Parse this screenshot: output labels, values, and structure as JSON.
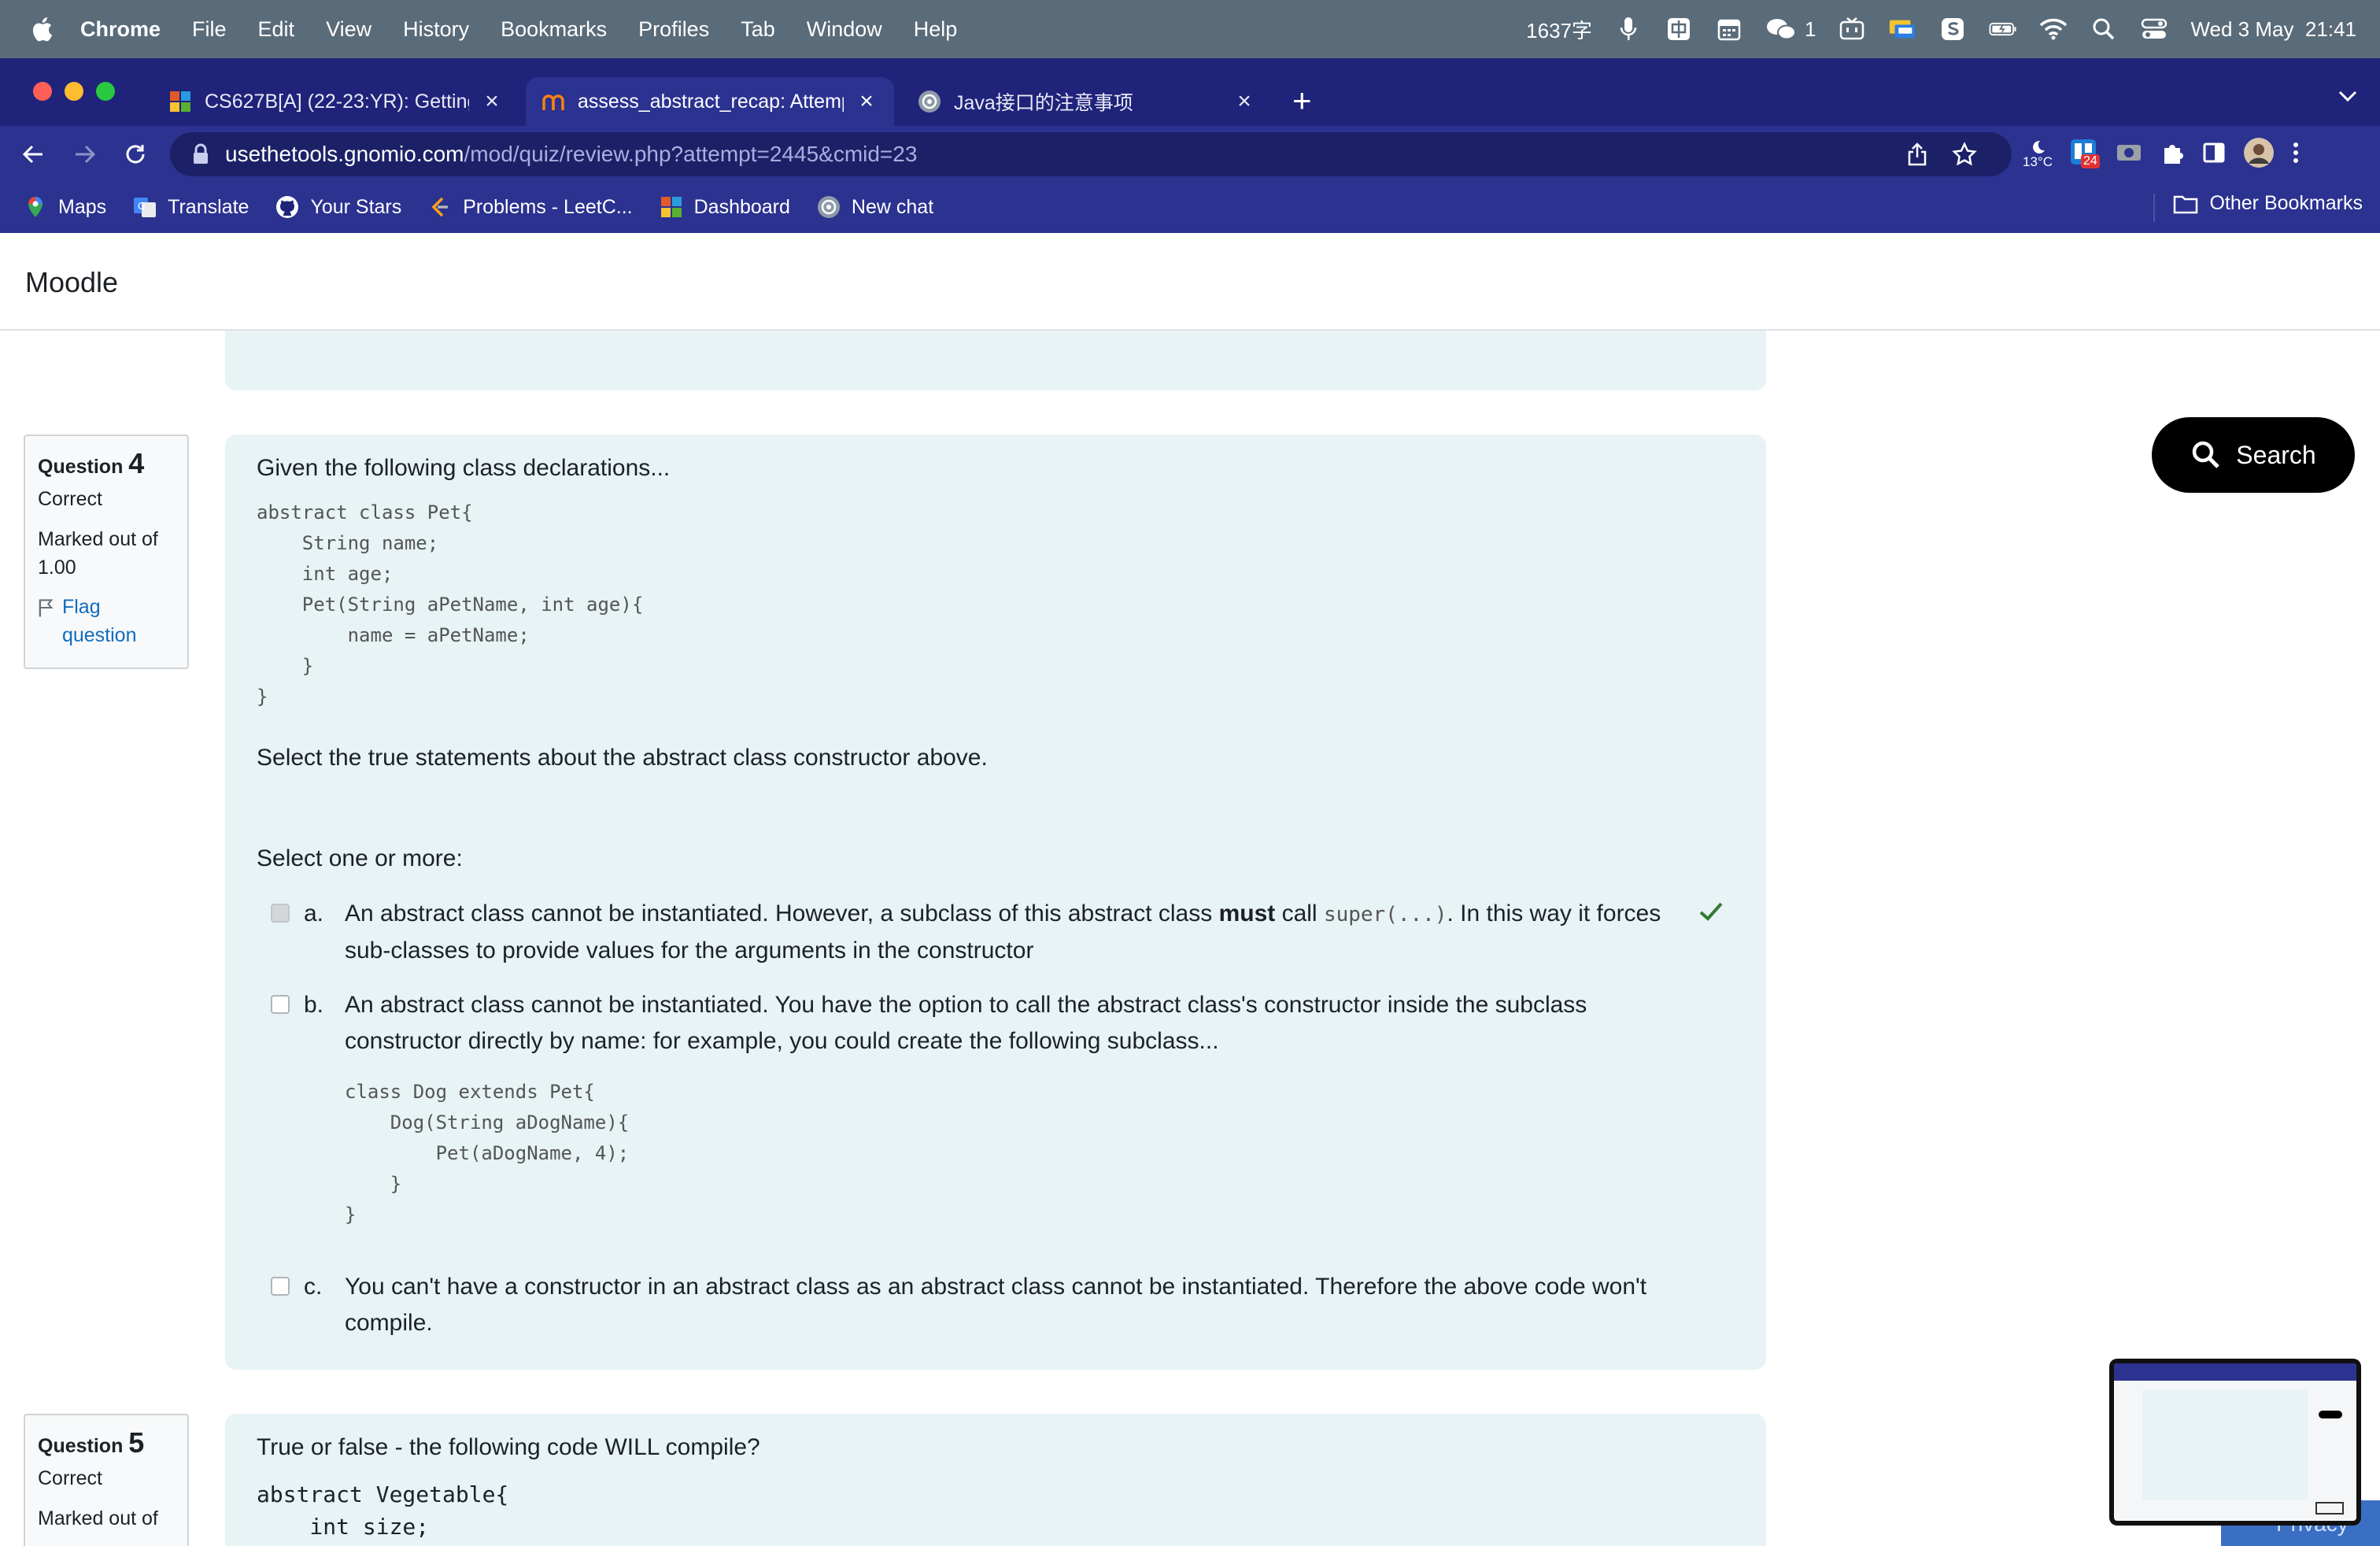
{
  "menubar": {
    "app": "Chrome",
    "items": [
      "File",
      "Edit",
      "View",
      "History",
      "Bookmarks",
      "Profiles",
      "Tab",
      "Window",
      "Help"
    ],
    "input_count": "1637字",
    "wechat_badge": "1",
    "datetime": "Wed 3 May  21:41"
  },
  "tabs": [
    {
      "title": "CS627B[A] (22-23:YR): Getting",
      "active": false
    },
    {
      "title": "assess_abstract_recap: Attemp",
      "active": true
    },
    {
      "title": "Java接口的注意事项",
      "active": false
    }
  ],
  "address": {
    "host": "usethetools.gnomio.com",
    "path": "/mod/quiz/review.php?attempt=2445&cmid=23"
  },
  "extensions": {
    "weather": "13°C",
    "badge": "24"
  },
  "bookmarks": [
    "Maps",
    "Translate",
    "Your Stars",
    "Problems - LeetC...",
    "Dashboard",
    "New chat"
  ],
  "other_bookmarks": "Other Bookmarks",
  "site": {
    "brand": "Moodle"
  },
  "search_button": "Search",
  "q4": {
    "label": "Question",
    "number": "4",
    "state": "Correct",
    "grade": "Marked out of 1.00",
    "flag": "Flag question",
    "intro": "Given the following class declarations...",
    "code": "abstract class Pet{\n    String name;\n    int age;\n    Pet(String aPetName, int age){\n        name = aPetName;\n    }\n}",
    "question": "Select the true statements about the abstract class constructor above.",
    "prompt": "Select one or more:",
    "answers": {
      "a": {
        "letter": "a.",
        "text_before": "An abstract class cannot be instantiated. However, a subclass of this abstract class ",
        "bold": "must",
        "text_mid": " call ",
        "code": "super(...)",
        "text_after": ". In this way it forces sub-classes to provide values for the arguments in the constructor"
      },
      "b": {
        "letter": "b.",
        "text": "An abstract class cannot be instantiated. You have the option to call the abstract class's constructor inside the subclass constructor directly by name: for example, you could create the following subclass...",
        "code": "class Dog extends Pet{\n    Dog(String aDogName){\n        Pet(aDogName, 4);\n    }\n}"
      },
      "c": {
        "letter": "c.",
        "text": "You can't have a constructor in an abstract class as an abstract class cannot be instantiated. Therefore the above code won't compile."
      }
    }
  },
  "q5": {
    "label": "Question",
    "number": "5",
    "state": "Correct",
    "grade": "Marked out of",
    "intro": "True or false - the following code WILL compile?",
    "code": "abstract Vegetable{\n    int size;"
  },
  "privacy": "Privacy"
}
